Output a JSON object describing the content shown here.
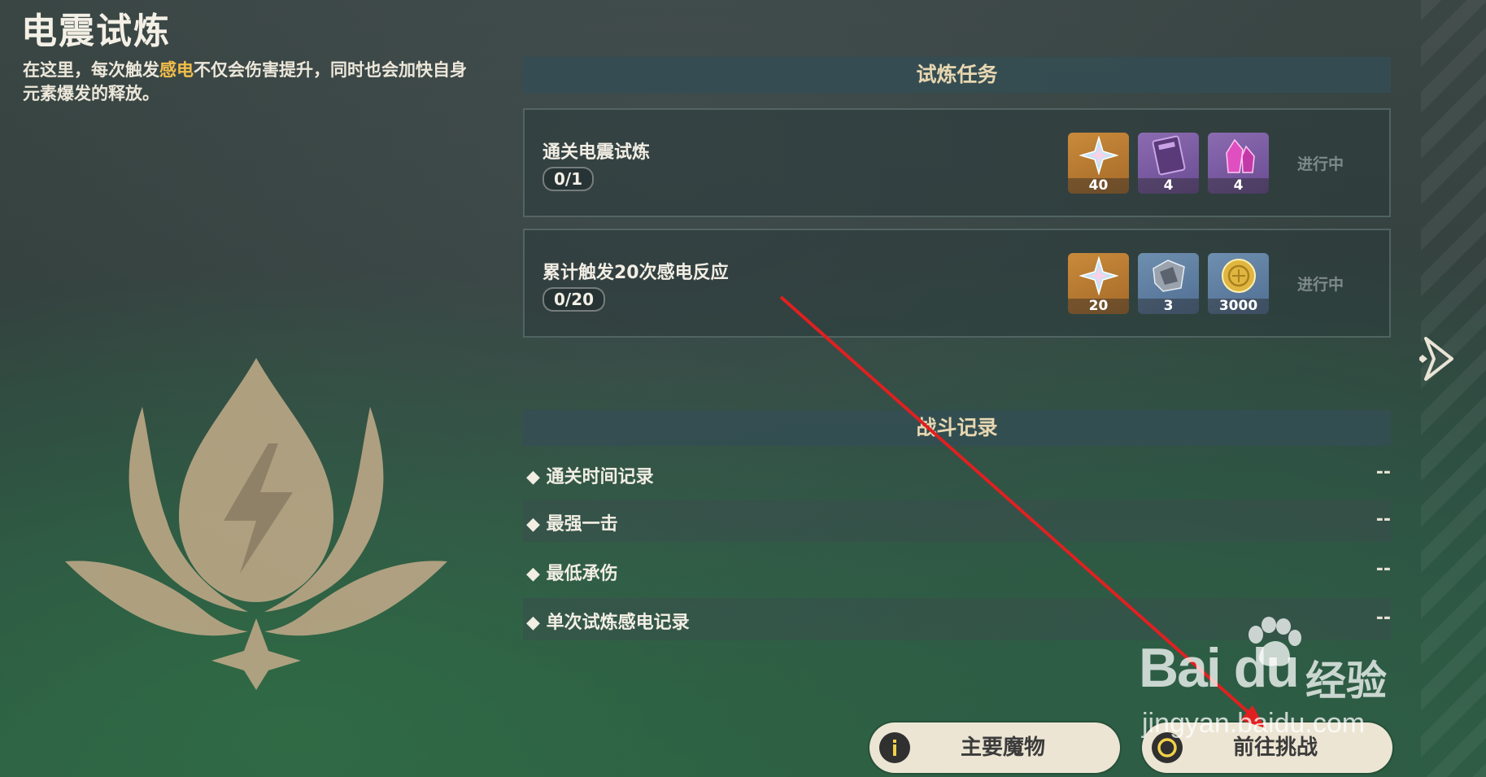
{
  "title": "电震试炼",
  "description": {
    "part1": "在这里，每次触发",
    "highlight": "感电",
    "part2": "不仅会伤害提升，同时也会加快自身元素爆发的释放。"
  },
  "tasks": {
    "header": "试炼任务",
    "items": [
      {
        "name": "通关电震试炼",
        "progress": "0/1",
        "status": "进行中",
        "rewards": [
          {
            "icon": "primogem-icon",
            "count": "40"
          },
          {
            "icon": "heros-wit-book-icon",
            "count": "4"
          },
          {
            "icon": "mystic-crystal-icon",
            "count": "4"
          }
        ]
      },
      {
        "name": "累计触发20次感电反应",
        "progress": "0/20",
        "status": "进行中",
        "rewards": [
          {
            "icon": "primogem-icon",
            "count": "20"
          },
          {
            "icon": "enhancement-ore-icon",
            "count": "3"
          },
          {
            "icon": "mora-icon",
            "count": "3000"
          }
        ]
      }
    ]
  },
  "records": {
    "header": "战斗记录",
    "items": [
      {
        "label": "◆ 通关时间记录",
        "value": "--"
      },
      {
        "label": "◆ 最强一击",
        "value": "--"
      },
      {
        "label": "◆ 最低承伤",
        "value": "--"
      },
      {
        "label": "◆ 单次试炼感电记录",
        "value": "--"
      }
    ]
  },
  "buttons": {
    "monsters": "主要魔物",
    "challenge": "前往挑战"
  },
  "watermark": {
    "brand": "Bai du",
    "cn": "经验",
    "url": "jingyan.baidu.com"
  },
  "colors": {
    "highlight": "#f3bf4a",
    "annotation_arrow": "#e02020",
    "button_bg": "#ece5d3"
  }
}
